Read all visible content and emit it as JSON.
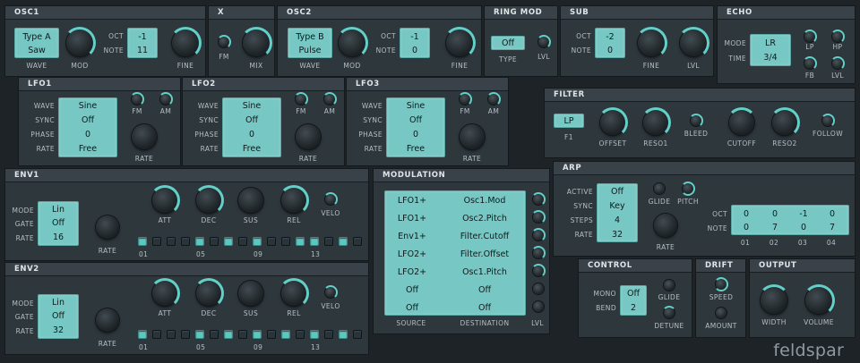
{
  "osc1": {
    "title": "OSC1",
    "wave": [
      "Type A",
      "Saw"
    ],
    "oct": "-1",
    "note": "11",
    "lbl_wave": "WAVE",
    "lbl_mod": "MOD",
    "lbl_oct": "OCT",
    "lbl_note": "NOTE",
    "lbl_fine": "FINE"
  },
  "x": {
    "title": "X",
    "lbl_fm": "FM",
    "lbl_mix": "MIX"
  },
  "osc2": {
    "title": "OSC2",
    "wave": [
      "Type B",
      "Pulse"
    ],
    "oct": "-1",
    "note": "0",
    "lbl_wave": "WAVE",
    "lbl_mod": "MOD",
    "lbl_oct": "OCT",
    "lbl_note": "NOTE",
    "lbl_fine": "FINE"
  },
  "ringmod": {
    "title": "RING MOD",
    "type": "Off",
    "lbl_type": "TYPE",
    "lbl_lvl": "LVL"
  },
  "sub": {
    "title": "SUB",
    "oct": "-2",
    "note": "0",
    "lbl_oct": "OCT",
    "lbl_note": "NOTE",
    "lbl_fine": "FINE",
    "lbl_lvl": "LVL"
  },
  "echo": {
    "title": "ECHO",
    "mode": "LR",
    "time": "3/4",
    "lbl_mode": "MODE",
    "lbl_time": "TIME",
    "lbl_lp": "LP",
    "lbl_hp": "HP",
    "lbl_fb": "FB",
    "lbl_lvl": "LVL"
  },
  "lfo_labels": {
    "wave": "WAVE",
    "sync": "SYNC",
    "phase": "PHASE",
    "rate": "RATE",
    "fm": "FM",
    "am": "AM",
    "rate_knob": "RATE"
  },
  "lfo1": {
    "title": "LFO1",
    "wave": "Sine",
    "sync": "Off",
    "phase": "0",
    "rate": "Free"
  },
  "lfo2": {
    "title": "LFO2",
    "wave": "Sine",
    "sync": "Off",
    "phase": "0",
    "rate": "Free"
  },
  "lfo3": {
    "title": "LFO3",
    "wave": "Sine",
    "sync": "Off",
    "phase": "0",
    "rate": "Free"
  },
  "filter": {
    "title": "FILTER",
    "type": "LP",
    "lbl_type": "F1",
    "lbl_offset": "OFFSET",
    "lbl_reso1": "RESO1",
    "lbl_bleed": "BLEED",
    "lbl_cutoff": "CUTOFF",
    "lbl_reso2": "RESO2",
    "lbl_follow": "FOLLOW"
  },
  "env_labels": {
    "mode": "MODE",
    "gate": "GATE",
    "rate": "RATE",
    "rate_knob": "RATE",
    "att": "ATT",
    "dec": "DEC",
    "sus": "SUS",
    "rel": "REL",
    "velo": "VELO",
    "steps": [
      "01",
      "05",
      "09",
      "13"
    ]
  },
  "env1": {
    "title": "ENV1",
    "mode": "Lin",
    "gate": "Off",
    "rate": "16",
    "steps_on": [
      1,
      0,
      0,
      0,
      1,
      0,
      1,
      0,
      1,
      0,
      0,
      1,
      1,
      0,
      1,
      0
    ]
  },
  "env2": {
    "title": "ENV2",
    "mode": "Lin",
    "gate": "Off",
    "rate": "32",
    "steps_on": [
      1,
      0,
      0,
      0,
      1,
      0,
      1,
      0,
      1,
      0,
      1,
      0,
      1,
      0,
      1,
      0
    ]
  },
  "modulation": {
    "title": "MODULATION",
    "sources": [
      "LFO1+",
      "LFO1+",
      "Env1+",
      "LFO2+",
      "LFO2+",
      "Off",
      "Off"
    ],
    "destinations": [
      "Osc1.Mod",
      "Osc2.Pitch",
      "Filter.Cutoff",
      "Filter.Offset",
      "Osc1.Pitch",
      "Off",
      "Off"
    ],
    "lbl_source": "SOURCE",
    "lbl_destination": "DESTINATION",
    "lbl_lvl": "LVL"
  },
  "arp": {
    "title": "ARP",
    "active": "Off",
    "sync": "Key",
    "steps": "4",
    "rate": "32",
    "lbl_active": "ACTIVE",
    "lbl_sync": "SYNC",
    "lbl_steps": "STEPS",
    "lbl_rate": "RATE",
    "lbl_glide": "GLIDE",
    "lbl_pitch": "PITCH",
    "lbl_rate_knob": "RATE",
    "lbl_oct": "OCT",
    "lbl_note": "NOTE",
    "oct": [
      "0",
      "0",
      "-1",
      "0"
    ],
    "note": [
      "0",
      "7",
      "0",
      "7"
    ],
    "cols": [
      "01",
      "02",
      "03",
      "04"
    ]
  },
  "control": {
    "title": "CONTROL",
    "mono": "Off",
    "bend": "2",
    "lbl_mono": "MONO",
    "lbl_bend": "BEND",
    "lbl_glide": "GLIDE",
    "lbl_detune": "DETUNE"
  },
  "drift": {
    "title": "DRIFT",
    "lbl_speed": "SPEED",
    "lbl_amount": "AMOUNT"
  },
  "output": {
    "title": "OUTPUT",
    "lbl_width": "WIDTH",
    "lbl_volume": "VOLUME"
  },
  "brand": "feldspar",
  "colors": {
    "accent": "#62cfc8",
    "display": "#77c8c4",
    "panel": "#2e373c",
    "background": "#1d2327"
  }
}
